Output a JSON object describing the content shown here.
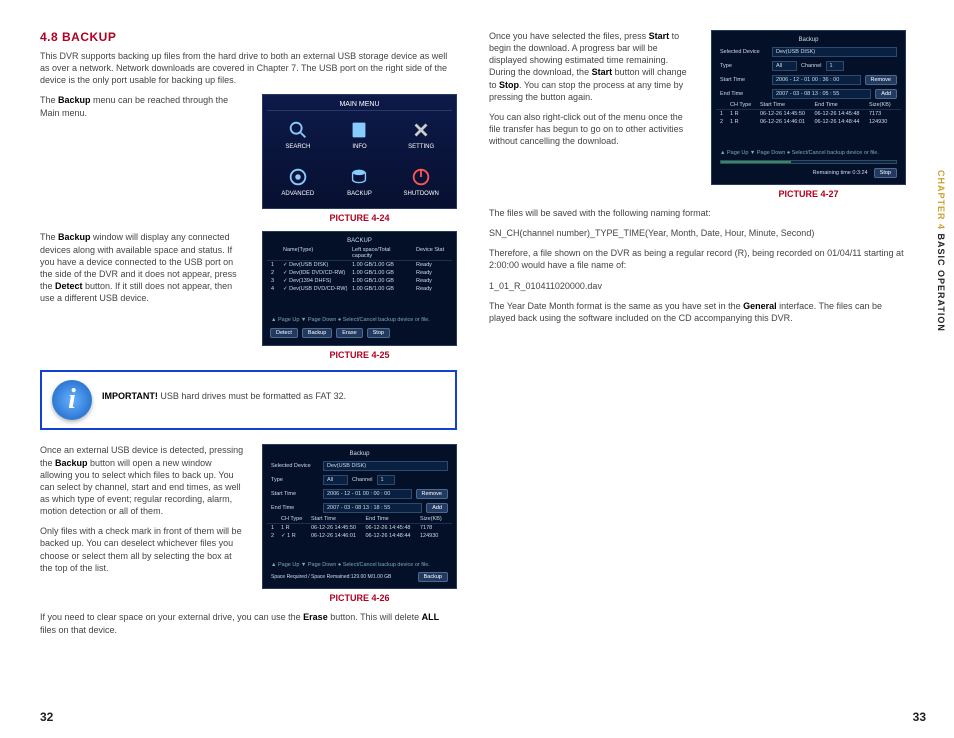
{
  "left": {
    "heading": "4.8 BACKUP",
    "intro": "This DVR supports backing up files from the hard drive to both an external USB storage device as well as over a network. Network downloads are covered in Chapter 7. The USB port on the right side of the device is the only port usable for backing up files.",
    "p_backup_menu_pre": "The ",
    "p_backup_menu_bold": "Backup",
    "p_backup_menu_post": " menu can be reached through the Main menu.",
    "caption24": "PICTURE 4-24",
    "menu_title": "MAIN MENU",
    "menu_items": [
      "SEARCH",
      "INFO",
      "SETTING",
      "ADVANCED",
      "BACKUP",
      "SHUTDOWN"
    ],
    "p_window_pre": "The ",
    "p_window_b1": "Backup",
    "p_window_mid": " window will display any connected devices along with available space and status. If you have a device connected to the USB port on the side of the DVR and it does not appear, press the ",
    "p_window_b2": "Detect",
    "p_window_post": " button. If it still does not appear, then use a different USB device.",
    "caption25": "PICTURE 4-25",
    "tbl25": {
      "title": "BACKUP",
      "headers": [
        "",
        "Name(Type)",
        "Left space/Total capacity",
        "Device Stat"
      ],
      "rows": [
        [
          "1",
          "✓ Dev(USB DISK)",
          "1.00 GB/1.00 GB",
          "Ready"
        ],
        [
          "2",
          "✓ Dev(IDE DVD/CD-RW)",
          "1.00 GB/1.00 GB",
          "Ready"
        ],
        [
          "3",
          "✓ Dev(1394 DHFS)",
          "1.00 GB/1.00 GB",
          "Ready"
        ],
        [
          "4",
          "✓ Dev(USB DVD/CD-RW)",
          "1.00 GB/1.00 GB",
          "Ready"
        ]
      ],
      "footer_hint": "▲ Page Up  ▼ Page Down  ● Select/Cancel backup device or file.",
      "buttons": [
        "Detect",
        "Backup",
        "Erase",
        "Stop"
      ]
    },
    "important_b": "IMPORTANT!",
    "important_t": " USB hard drives must be formatted as FAT 32.",
    "p_ext_pre": "Once an external USB device is detected, pressing the ",
    "p_ext_b": "Backup",
    "p_ext_post": " button will open a new window allowing you to select which files to back up. You can select by channel, start and end times, as well as which type of event; regular recording, alarm, motion detection or all of them.",
    "p_only": "Only files with a check mark in front of them will be backed up. You can deselect whichever files you choose or select them all by selecting the box at the top of the list.",
    "caption26": "PICTURE 4-26",
    "tbl26": {
      "title": "Backup",
      "sel_label": "Selected Device",
      "sel_val": "Dev(USB DISK)",
      "type_l": "Type",
      "type_v": "All",
      "ch_l": "Channel",
      "ch_v": "1",
      "start_l": "Start Time",
      "start_v": "2006 - 12 - 01  00 : 00 : 00",
      "end_l": "End Time",
      "end_v": "2007 - 03 - 08  13 : 18 : 55",
      "btn_remove": "Remove",
      "btn_add": "Add",
      "headers": [
        "",
        "CH Type",
        "Start Time",
        "End Time",
        "Size(KB)"
      ],
      "rows": [
        [
          "1",
          "1 R",
          "06-12-26 14:45:50",
          "06-12-26 14:45:48",
          "7178"
        ],
        [
          "2",
          "✓ 1 R",
          "06-12-26 14:46:01",
          "06-12-26 14:48:44",
          "124930"
        ]
      ],
      "footer_hint": "▲ Page Up  ▼ Page Down  ● Select/Cancel backup device or file.",
      "space": "Space Required / Space Remained:129.00 M/1.00 GB",
      "btn_backup": "Backup"
    },
    "p_erase_pre": "If you need to clear space on your external drive, you can use the ",
    "p_erase_b": "Erase",
    "p_erase_mid": " button. This will delete ",
    "p_erase_b2": "ALL",
    "p_erase_post": " files on that device."
  },
  "right": {
    "p1_pre": "Once you have selected the files, press ",
    "p1_b1": "Start",
    "p1_mid1": " to begin the download. A progress bar will be displayed showing estimated time remaining. During the download, the ",
    "p1_b2": "Start",
    "p1_mid2": " button will change to ",
    "p1_b3": "Stop",
    "p1_post": ". You can stop the process at any time by pressing the button again.",
    "p2": "You can also right-click out of the menu once the file transfer has begun to go on to other activities without cancelling the download.",
    "caption27": "PICTURE 4-27",
    "tbl27": {
      "title": "Backup",
      "sel_label": "Selected Device",
      "sel_val": "Dev(USB DISK)",
      "type_l": "Type",
      "type_v": "All",
      "ch_l": "Channel",
      "ch_v": "1",
      "start_l": "Start Time",
      "start_v": "2006 - 12 - 01  00 : 36 : 00",
      "end_l": "End Time",
      "end_v": "2007 - 03 - 08  13 : 05 : 55",
      "btn_remove": "Remove",
      "btn_add": "Add",
      "headers": [
        "",
        "CH Type",
        "Start Time",
        "End Time",
        "Size(KB)"
      ],
      "rows": [
        [
          "1",
          "1 R",
          "06-12-26 14:45:50",
          "06-12-26 14:45:48",
          "7173"
        ],
        [
          "2",
          "1 R",
          "06-12-26 14:46:01",
          "06-12-26 14:48:44",
          "124930"
        ]
      ],
      "footer_hint": "▲ Page Up  ▼ Page Down  ● Select/Cancel backup device or file.",
      "remaining": "Remaining time 0:3:24",
      "btn_stop": "Stop"
    },
    "p3": "The files will be saved with the following naming format:",
    "p4": "SN_CH(channel number)_TYPE_TIME(Year, Month, Date, Hour, Minute, Second)",
    "p5": "Therefore, a file shown on the DVR as being a regular record (R), being recorded on 01/04/11 starting at 2:00:00 would have a file name of:",
    "p6": "1_01_R_010411020000.dav",
    "p7_pre": " The Year Date Month format is the same as you have set in the ",
    "p7_b": "General",
    "p7_post": " interface. The files can be played back using the software included on the CD accompanying this DVR."
  },
  "side": {
    "ch": "CHAPTER 4 ",
    "rest": "BASIC OPERATION"
  },
  "pages": {
    "left": "32",
    "right": "33"
  }
}
